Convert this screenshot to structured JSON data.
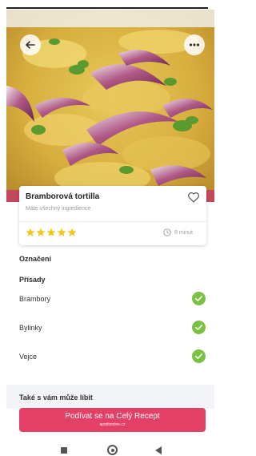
{
  "hero": {
    "image": "potato-tortilla-photo",
    "back_icon": "arrow-left-icon",
    "more_icon": "more-dots-icon"
  },
  "recipe_card": {
    "title": "Bramborová tortilla",
    "subtitle": "Máte všechny ingredience",
    "rating": 5,
    "rating_max": 5,
    "time": "8 minut",
    "heart_icon": "heart-outline-icon",
    "clock_icon": "clock-icon"
  },
  "sections": {
    "labels_title": "Označení",
    "ingredients_title": "Přísady"
  },
  "ingredients": [
    {
      "name": "Brambory",
      "available": true
    },
    {
      "name": "Bylinky",
      "available": true
    },
    {
      "name": "Vejce",
      "available": true
    }
  ],
  "recommendations": {
    "title": "Také s vám může líbit"
  },
  "cta": {
    "label": "Podívat se na Celý Recept",
    "source": "apetitonline.cz"
  },
  "colors": {
    "accent": "#e43f64",
    "star": "#f5c518",
    "check": "#7ac142"
  },
  "nav": {
    "recents_icon": "square-icon",
    "home_icon": "circle-icon",
    "back_icon": "triangle-back-icon"
  }
}
